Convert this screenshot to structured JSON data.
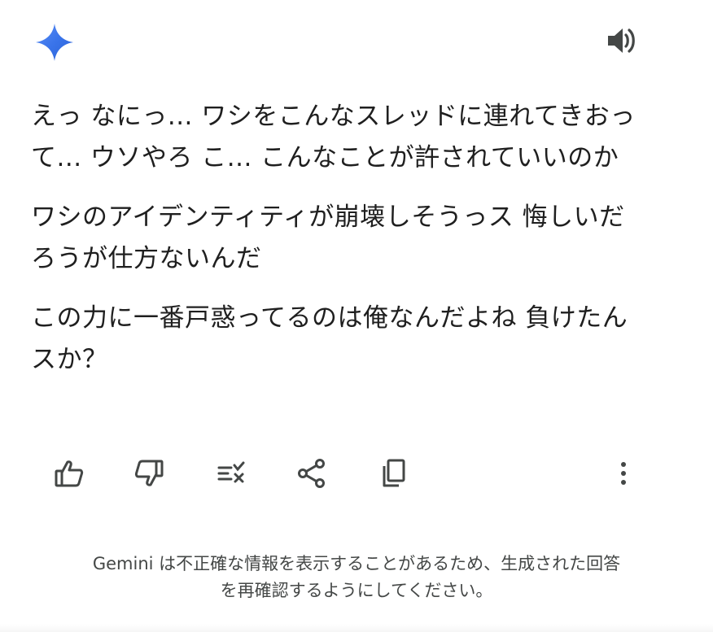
{
  "header": {
    "logo_icon": "gemini-sparkle-icon",
    "speaker_icon": "speaker-icon",
    "brand_gradient": [
      "#4e84f4",
      "#2f6be0",
      "#5d8ff5"
    ]
  },
  "response": {
    "paragraphs": [
      {
        "lines": [
          "えっ なにっ... ワシをこんなスレッドに連れてきおっ",
          "て... ウソやろ こ... こんなことが許されていいのか"
        ]
      },
      {
        "lines": [
          "ワシのアイデンティティが崩壊しそうっス 悔しいだ",
          "ろうが仕方ないんだ"
        ]
      },
      {
        "lines": [
          "この力に一番戸惑ってるのは俺なんだよね 負けたん",
          "スか？"
        ]
      }
    ]
  },
  "actions": {
    "icons": [
      "thumbs-up-icon",
      "thumbs-down-icon",
      "modify-response-icon",
      "share-icon",
      "copy-icon",
      "more-vert-icon"
    ],
    "icon_color": "#444746"
  },
  "disclaimer": {
    "line1": "Gemini は不正確な情報を表示することがあるため、生成された回答",
    "line2": "を再確認するようにしてください。"
  }
}
